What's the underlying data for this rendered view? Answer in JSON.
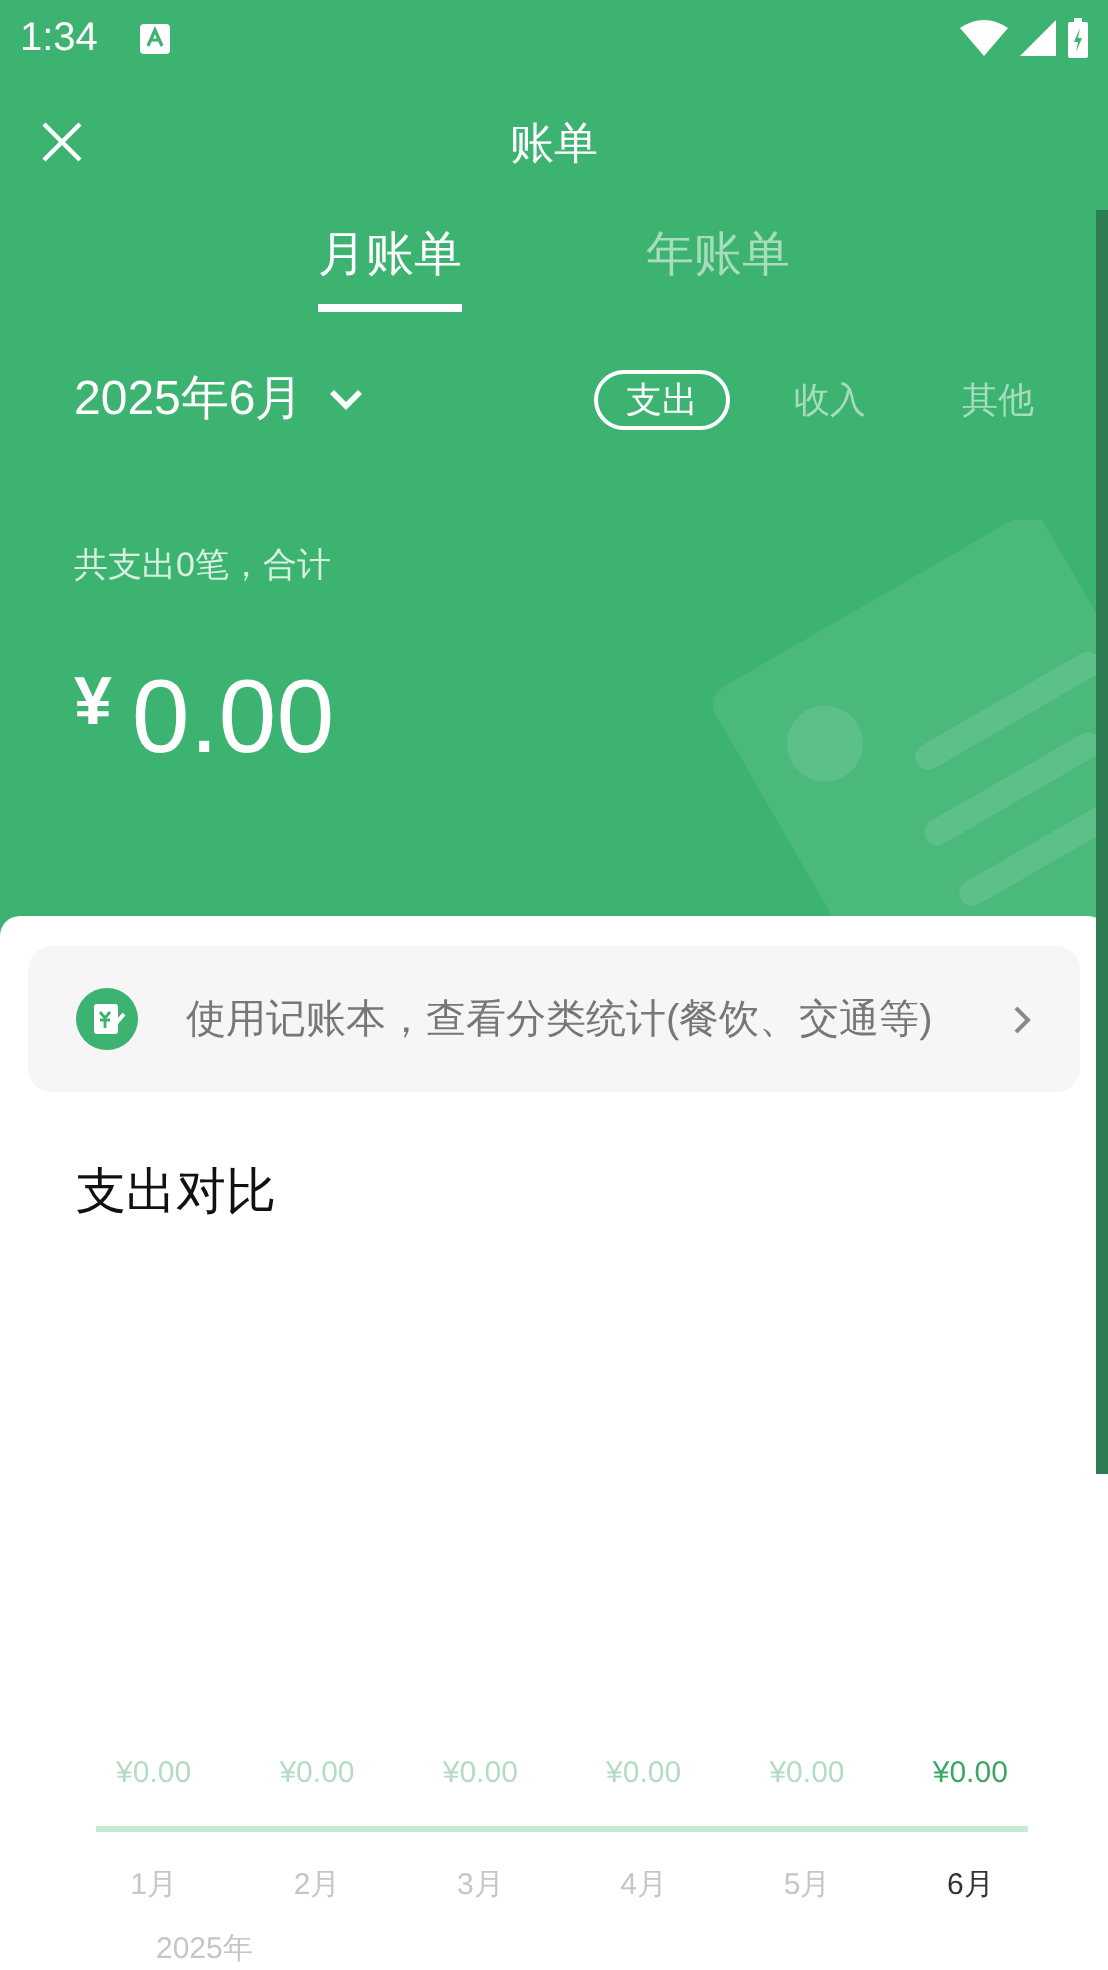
{
  "status_bar": {
    "time": "1:34"
  },
  "header": {
    "title": "账单"
  },
  "tabs": [
    {
      "label": "月账单",
      "selected": true
    },
    {
      "label": "年账单",
      "selected": false
    }
  ],
  "period": {
    "label": "2025年6月"
  },
  "type_filters": [
    {
      "label": "支出",
      "selected": true
    },
    {
      "label": "收入",
      "selected": false
    },
    {
      "label": "其他",
      "selected": false
    }
  ],
  "summary": {
    "caption": "共支出0笔，合计",
    "currency": "¥",
    "amount": "0.00"
  },
  "banner": {
    "text": "使用记账本，查看分类统计(餐饮、交通等)"
  },
  "comparison": {
    "title": "支出对比",
    "year": "2025年",
    "months": [
      {
        "value": "¥0.00",
        "label": "1月",
        "selected": false
      },
      {
        "value": "¥0.00",
        "label": "2月",
        "selected": false
      },
      {
        "value": "¥0.00",
        "label": "3月",
        "selected": false
      },
      {
        "value": "¥0.00",
        "label": "4月",
        "selected": false
      },
      {
        "value": "¥0.00",
        "label": "5月",
        "selected": false
      },
      {
        "value": "¥0.00",
        "label": "6月",
        "selected": true
      }
    ]
  }
}
